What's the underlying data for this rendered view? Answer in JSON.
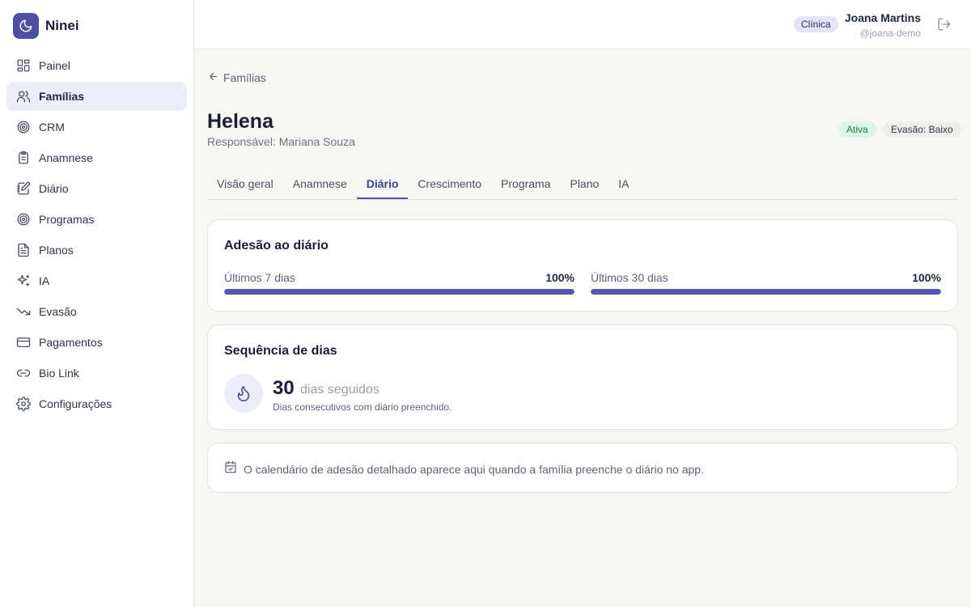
{
  "brand": {
    "name": "Ninei"
  },
  "sidebar": {
    "items": [
      {
        "label": "Painel",
        "icon": "dashboard-icon"
      },
      {
        "label": "Famílias",
        "icon": "users-icon",
        "active": true
      },
      {
        "label": "CRM",
        "icon": "target-icon"
      },
      {
        "label": "Anamnese",
        "icon": "clipboard-icon"
      },
      {
        "label": "Diário",
        "icon": "journal-icon"
      },
      {
        "label": "Programas",
        "icon": "target-icon"
      },
      {
        "label": "Planos",
        "icon": "document-icon"
      },
      {
        "label": "IA",
        "icon": "sparkles-icon"
      },
      {
        "label": "Evasão",
        "icon": "trending-down-icon"
      },
      {
        "label": "Pagamentos",
        "icon": "credit-card-icon"
      },
      {
        "label": "Bio Link",
        "icon": "link-icon"
      },
      {
        "label": "Configurações",
        "icon": "gear-icon"
      }
    ]
  },
  "header": {
    "role_badge": "Clínica",
    "user_name": "Joana Martins",
    "user_handle": "@joana-demo"
  },
  "main": {
    "back_label": "Famílias",
    "child_name": "Helena",
    "guardian": "Responsável: Mariana Souza",
    "status_badge": "Ativa",
    "risk_badge": "Evasão: Baixo",
    "tabs": [
      {
        "label": "Visão geral"
      },
      {
        "label": "Anamnese"
      },
      {
        "label": "Diário",
        "active": true
      },
      {
        "label": "Crescimento"
      },
      {
        "label": "Programa"
      },
      {
        "label": "Plano"
      },
      {
        "label": "IA"
      }
    ],
    "adherence": {
      "title": "Adesão ao diário",
      "last7": {
        "label": "Últimos 7 dias",
        "value_text": "100%",
        "value": 100
      },
      "last30": {
        "label": "Últimos 30 dias",
        "value_text": "100%",
        "value": 100
      }
    },
    "streak": {
      "title": "Sequência de dias",
      "count": "30",
      "unit": "dias seguidos",
      "description": "Dias consecutivos com diário preenchido."
    },
    "calendar_note": "O calendário de adesão detalhado aparece aqui quando a família preenche o diário no app."
  },
  "colors": {
    "accent": "#4d4fa3",
    "progress": "#5557b0",
    "active_nav_bg": "#eceefb",
    "status_green_bg": "#dcf5e6",
    "page_bg": "#f8f6f2"
  }
}
